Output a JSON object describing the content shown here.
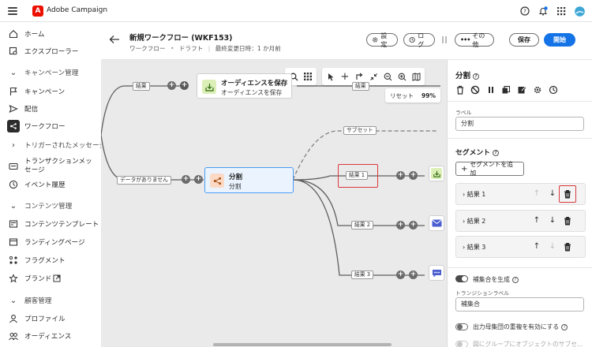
{
  "app": {
    "name": "Adobe Campaign"
  },
  "colors": {
    "accent": "#1473e6",
    "brand": "#eb1000",
    "highlight": "#d9373d",
    "node_border": "#4b9cf5"
  },
  "sidebar": {
    "items": [
      {
        "label": "ホーム",
        "icon": "home-icon",
        "type": "item"
      },
      {
        "label": "エクスプローラー",
        "icon": "explorer-icon",
        "type": "item"
      },
      {
        "label": "キャンペーン管理",
        "icon": "chevron-down-icon",
        "type": "section"
      },
      {
        "label": "キャンペーン",
        "icon": "flag-icon",
        "type": "item"
      },
      {
        "label": "配信",
        "icon": "send-icon",
        "type": "item"
      },
      {
        "label": "ワークフロー",
        "icon": "workflow-icon",
        "type": "active"
      },
      {
        "label": "トリガーされたメッセージ",
        "icon": "chevron-right-icon",
        "type": "section"
      },
      {
        "label": "トランザクションメッセージ",
        "icon": "transaction-icon",
        "type": "item"
      },
      {
        "label": "イベント履歴",
        "icon": "event-icon",
        "type": "item"
      },
      {
        "label": "コンテンツ管理",
        "icon": "chevron-down-icon",
        "type": "section"
      },
      {
        "label": "コンテンツテンプレート",
        "icon": "template-icon",
        "type": "item"
      },
      {
        "label": "ランディングページ",
        "icon": "landing-icon",
        "type": "item"
      },
      {
        "label": "フラグメント",
        "icon": "fragment-icon",
        "type": "item"
      },
      {
        "label": "ブランド",
        "icon": "brand-icon",
        "type": "item"
      },
      {
        "label": "顧客管理",
        "icon": "chevron-down-icon",
        "type": "section"
      },
      {
        "label": "プロファイル",
        "icon": "profile-icon",
        "type": "item"
      },
      {
        "label": "オーディエンス",
        "icon": "audience-icon",
        "type": "item"
      }
    ]
  },
  "workflow": {
    "title": "新規ワークフロー (WKF153)",
    "type": "ワークフロー",
    "status": "ドラフト",
    "last_modified": "最終変更日時：1 か月前",
    "buttons": {
      "settings": "設定",
      "log": "ログ",
      "more": "その他",
      "save": "保存",
      "start": "開始"
    }
  },
  "canvas": {
    "toolbar_zoom": "99%",
    "reset_label": "リセット",
    "nodes": {
      "save_audience": {
        "title": "オーディエンスを保存",
        "subtitle": "オーディエンスを保存"
      },
      "split": {
        "title": "分割",
        "subtitle": "分割"
      }
    },
    "labels": {
      "result_top": "結果",
      "result_top2": "結果",
      "no_data": "データがありません",
      "subset": "サブセット",
      "result1": "結果 1",
      "result2": "結果 2",
      "result3": "結果 3"
    }
  },
  "panel": {
    "title": "分割",
    "label_caption": "ラベル",
    "label_value": "分割",
    "segments_title": "セグメント",
    "add_segment": "セグメントを追加",
    "segments": [
      {
        "name": "結果 1"
      },
      {
        "name": "結果 2"
      },
      {
        "name": "結果 3"
      }
    ],
    "complement_toggle": "補集合を生成",
    "transition_caption": "トランジションラベル",
    "transition_value": "補集合",
    "overlap_toggle": "出力母集団の重複を有効にする",
    "cut_text": "図にグループにオブジェクトのサブセ..."
  }
}
